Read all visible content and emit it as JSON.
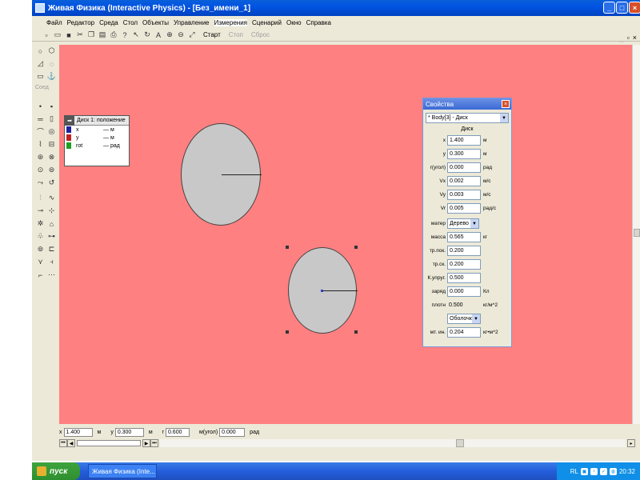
{
  "window": {
    "title": "Живая Физика (Interactive Physics) - [Без_имени_1]"
  },
  "menu": [
    "Файл",
    "Редактор",
    "Среда",
    "Стол",
    "Объекты",
    "Управление",
    "Измерения",
    "Сценарий",
    "Окно",
    "Справка"
  ],
  "toolbar": {
    "start_label": "Старт",
    "stop_label": "Стоп",
    "reset_label": "Сброс"
  },
  "left_tools": {
    "section_label": "Соед"
  },
  "meter": {
    "title": "Диск 1: положение",
    "rows": [
      {
        "name": "x",
        "value": "— м"
      },
      {
        "name": "y",
        "value": "— м"
      },
      {
        "name": "rot",
        "value": "— рад"
      }
    ]
  },
  "properties": {
    "title": "Свойства",
    "object": "* Body[3] - Диск",
    "header": "Диск",
    "fields": [
      {
        "label": "x",
        "value": "1.400",
        "unit": "м"
      },
      {
        "label": "y",
        "value": "0.300",
        "unit": "м"
      },
      {
        "label": "r(угол)",
        "value": "0.000",
        "unit": "рад"
      },
      {
        "label": "Vx",
        "value": "0.002",
        "unit": "м/с"
      },
      {
        "label": "Vy",
        "value": "0.003",
        "unit": "м/с"
      },
      {
        "label": "Vr",
        "value": "0.005",
        "unit": "рад/с"
      }
    ],
    "material_label": "матер",
    "material_value": "Дерево",
    "fields2": [
      {
        "label": "масса",
        "value": "0.565",
        "unit": "кг"
      },
      {
        "label": "тр.пок.",
        "value": "0.200",
        "unit": ""
      },
      {
        "label": "тр.ск.",
        "value": "0.200",
        "unit": ""
      },
      {
        "label": "К.упруг.",
        "value": "0.500",
        "unit": ""
      },
      {
        "label": "заряд",
        "value": "0.000",
        "unit": "Кл"
      }
    ],
    "density_label": "плотн",
    "density_value": "0.500",
    "density_unit": "кг/м^2",
    "shell_value": "Оболочка",
    "moment_label": "мт. ин.",
    "moment_value": "0.204",
    "moment_unit": "кг•м^2"
  },
  "status": {
    "x_label": "x",
    "x_value": "1.400",
    "x_unit": "м",
    "y_label": "y",
    "y_value": "0.300",
    "y_unit": "м",
    "r_label": "r",
    "r_value": "0.600",
    "angle_label": "м(угол)",
    "angle_value": "0.000",
    "angle_unit": "рад"
  },
  "taskbar": {
    "start": "пуск",
    "task": "Живая Физика (Inte...",
    "lang": "RL",
    "clock": "20:32"
  }
}
